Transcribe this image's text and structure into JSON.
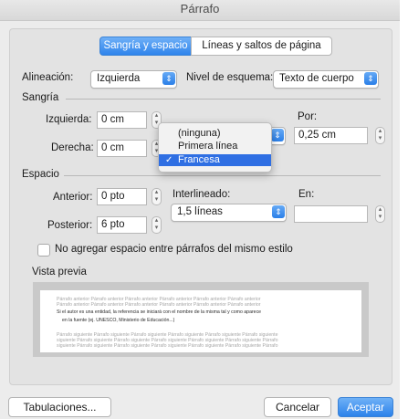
{
  "window": {
    "title": "Párrafo"
  },
  "tabs": {
    "indent_spacing": "Sangría y espacio",
    "line_page_breaks": "Líneas y saltos de página"
  },
  "alignment": {
    "label": "Alineación:",
    "value": "Izquierda"
  },
  "outline": {
    "label": "Nivel de esquema:",
    "value": "Texto de cuerpo"
  },
  "indent": {
    "section_label": "Sangría",
    "left_label": "Izquierda:",
    "left_value": "0 cm",
    "right_label": "Derecha:",
    "right_value": "0 cm",
    "by_label": "Por:",
    "by_value": "0,25 cm",
    "special_menu": {
      "items": [
        "(ninguna)",
        "Primera línea",
        "Francesa"
      ],
      "selected": "Francesa",
      "checkmark": "✓"
    }
  },
  "spacing": {
    "section_label": "Espacio",
    "before_label": "Anterior:",
    "before_value": "0 pto",
    "after_label": "Posterior:",
    "after_value": "6 pto",
    "line_spacing_label": "Interlineado:",
    "line_spacing_value": "1,5 líneas",
    "at_label": "En:",
    "at_value": ""
  },
  "dont_add_space": {
    "label": "No agregar espacio entre párrafos del mismo estilo",
    "checked": false
  },
  "preview": {
    "label": "Vista previa",
    "prev_lines": [
      "Párrafo anterior Párrafo anterior Párrafo anterior Párrafo anterior Párrafo anterior Párrafo anterior",
      "Párrafo anterior Párrafo anterior Párrafo anterior Párrafo anterior Párrafo anterior Párrafo anterior"
    ],
    "current_lines": [
      "Si el autor es una entidad, la referencia se iniciará con el nombre de la misma tal y como aparece",
      "en la fuente (ej. UNESCO, Ministerio de Educación...)"
    ],
    "next_lines": [
      "Párrafo siguiente Párrafo siguiente Párrafo siguiente Párrafo siguiente Párrafo siguiente Párrafo siguiente",
      "siguiente Párrafo siguiente Párrafo siguiente Párrafo siguiente Párrafo siguiente Párrafo siguiente Párrafo",
      "siguiente Párrafo siguiente Párrafo siguiente Párrafo siguiente Párrafo siguiente Párrafo siguiente Párrafo"
    ]
  },
  "buttons": {
    "tabs": "Tabulaciones...",
    "cancel": "Cancelar",
    "accept": "Aceptar"
  },
  "colors": {
    "accent": "#2f84ec",
    "menu_highlight": "#2f6fe3",
    "window_bg": "#ececec"
  },
  "icons": {
    "popup_arrows": "⇕",
    "stepper": "chevron-up-down"
  }
}
